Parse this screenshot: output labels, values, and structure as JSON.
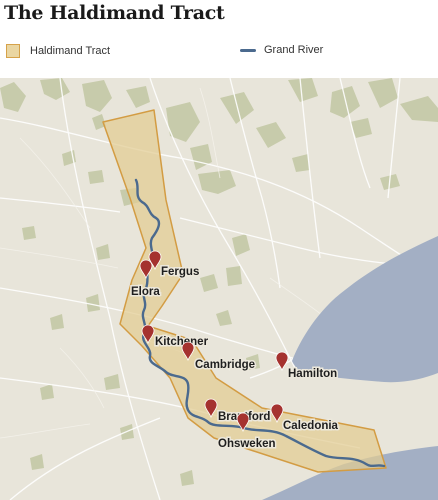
{
  "title": "The Haldimand Tract",
  "legend": {
    "tract_label": "Haldimand Tract",
    "river_label": "Grand River"
  },
  "colors": {
    "land": "#e8e5da",
    "water": "#a3afc4",
    "green": "#c4c9a6",
    "tract_fill": "#e2cc92",
    "tract_stroke": "#d39c43",
    "river": "#4b6a8e",
    "marker": "#a5322f",
    "roads": "#ffffff"
  },
  "places": [
    {
      "name": "Fergus",
      "icon": "map-pin-icon"
    },
    {
      "name": "Elora",
      "icon": "map-pin-icon"
    },
    {
      "name": "Kitchener",
      "icon": "map-pin-icon"
    },
    {
      "name": "Cambridge",
      "icon": "map-pin-icon"
    },
    {
      "name": "Hamilton",
      "icon": "map-pin-icon"
    },
    {
      "name": "Brantford",
      "icon": "map-pin-icon"
    },
    {
      "name": "Ohsweken",
      "icon": "map-pin-icon"
    },
    {
      "name": "Caledonia",
      "icon": "map-pin-icon"
    }
  ]
}
